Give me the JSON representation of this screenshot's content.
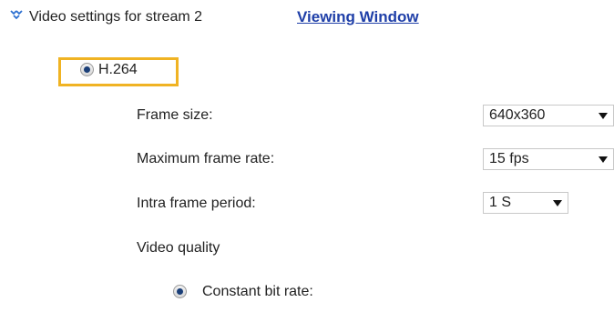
{
  "header": {
    "icon": "chevron-double-down-icon",
    "title": "Video settings for stream 2",
    "link": "Viewing Window"
  },
  "codec": {
    "label": "H.264",
    "selected": true,
    "highlight_color": "#f0b323"
  },
  "settings": {
    "frame_size": {
      "label": "Frame size:",
      "value": "640x360"
    },
    "max_frame_rate": {
      "label": "Maximum frame rate:",
      "value": "15 fps"
    },
    "intra_frame_period": {
      "label": "Intra frame period:",
      "value": "1 S"
    },
    "video_quality": {
      "label": "Video quality"
    }
  },
  "quality_mode": {
    "label": "Constant bit rate:",
    "selected": true
  },
  "colors": {
    "link": "#1f3fa8",
    "radio_dot": "#1b3f78"
  }
}
